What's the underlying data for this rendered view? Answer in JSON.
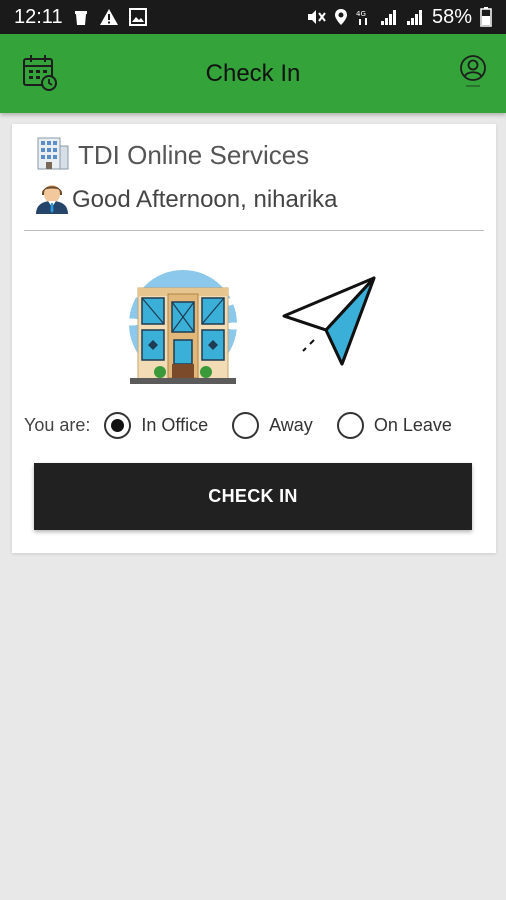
{
  "status_bar": {
    "time": "12:11",
    "battery": "58%",
    "icons_left": [
      "coffee-cup-icon",
      "warning-icon",
      "image-icon"
    ],
    "icons_right": [
      "mute-vibrate-icon",
      "location-icon",
      "4g-signal-icon",
      "signal-bars-icon",
      "battery-icon"
    ]
  },
  "app_bar": {
    "title": "Check In",
    "left_icon": "calendar-clock-icon",
    "right_icon": "profile-icon",
    "color": "#33a33a"
  },
  "card": {
    "company_icon": "office-building-icon",
    "company_name": "TDI Online Services",
    "user_icon": "person-avatar-icon",
    "greeting": "Good Afternoon, niharika"
  },
  "illustrations": {
    "office": "office-building-illustration",
    "plane": "paper-plane-illustration"
  },
  "status_selector": {
    "label": "You are:",
    "options": [
      {
        "label": "In Office",
        "selected": true
      },
      {
        "label": "Away",
        "selected": false
      },
      {
        "label": "On Leave",
        "selected": false
      }
    ]
  },
  "actions": {
    "check_in_label": "CHECK IN",
    "button_color": "#212121"
  }
}
